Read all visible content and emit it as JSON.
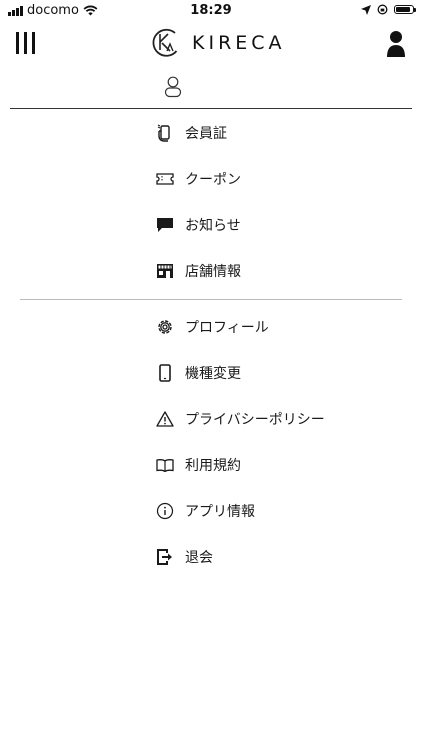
{
  "status_bar": {
    "carrier": "docomo",
    "time": "18:29",
    "battery_level": 0.85
  },
  "header": {
    "logo_text": "KIRECA",
    "menu_icon": "hamburger-vertical-icon",
    "account_icon": "user-icon"
  },
  "menu": {
    "group1": [
      {
        "label": "会員証",
        "icon": "phone-hand-icon"
      },
      {
        "label": "クーポン",
        "icon": "ticket-icon"
      },
      {
        "label": "お知らせ",
        "icon": "message-icon"
      },
      {
        "label": "店舗情報",
        "icon": "store-icon"
      }
    ],
    "group2": [
      {
        "label": "プロフィール",
        "icon": "gear-icon"
      },
      {
        "label": "機種変更",
        "icon": "smartphone-icon"
      },
      {
        "label": "プライバシーポリシー",
        "icon": "warning-icon"
      },
      {
        "label": "利用規約",
        "icon": "book-icon"
      },
      {
        "label": "アプリ情報",
        "icon": "info-icon"
      },
      {
        "label": "退会",
        "icon": "exit-icon"
      }
    ]
  },
  "colors": {
    "text": "#1a1a1a",
    "background": "#ffffff",
    "divider": "#bbbbbb"
  }
}
